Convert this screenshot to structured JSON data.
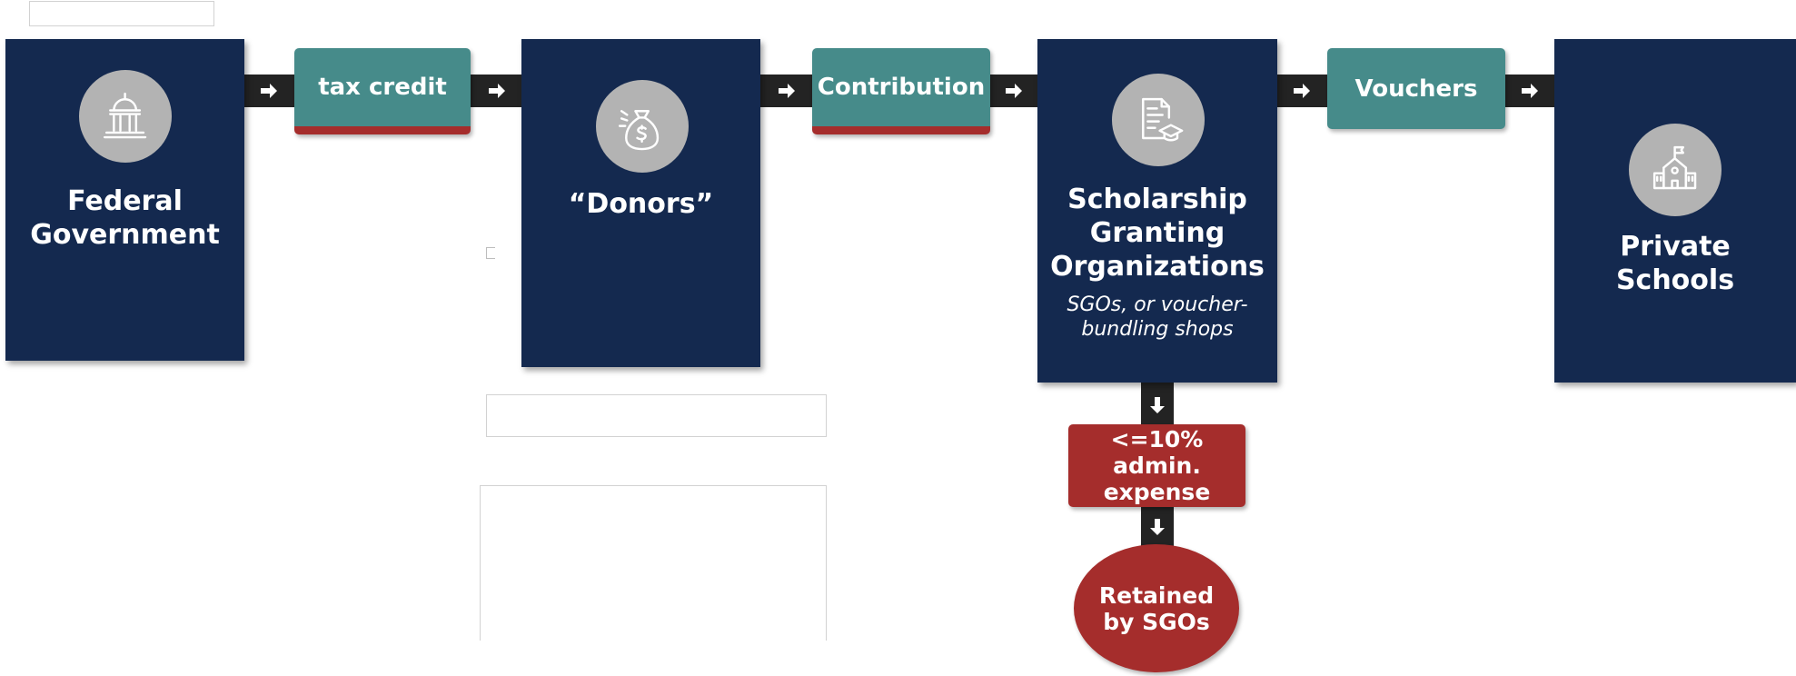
{
  "colors": {
    "card_navy": "#14294f",
    "connector_dark": "#232323",
    "teal": "#468b8a",
    "red": "#a52d2c",
    "icon_circle_gray": "#b3b3b3"
  },
  "nodes": {
    "federal": {
      "title": "Federal\nGovernment",
      "icon": "capitol-building-icon"
    },
    "donors": {
      "title": "“Donors”",
      "icon": "money-bag-icon"
    },
    "sgo": {
      "title": "Scholarship\nGranting\nOrganizations",
      "subtitle": "SGOs, or voucher-\nbundling shops",
      "icon": "document-graduation-cap-icon"
    },
    "schools": {
      "title": "Private\nSchools",
      "icon": "school-building-icon"
    }
  },
  "flows": {
    "tax_credit": "tax credit",
    "contribution": "Contribution",
    "vouchers": "Vouchers",
    "admin_expense": "<=10% admin.\nexpense",
    "retained": "Retained\nby SGOs"
  }
}
